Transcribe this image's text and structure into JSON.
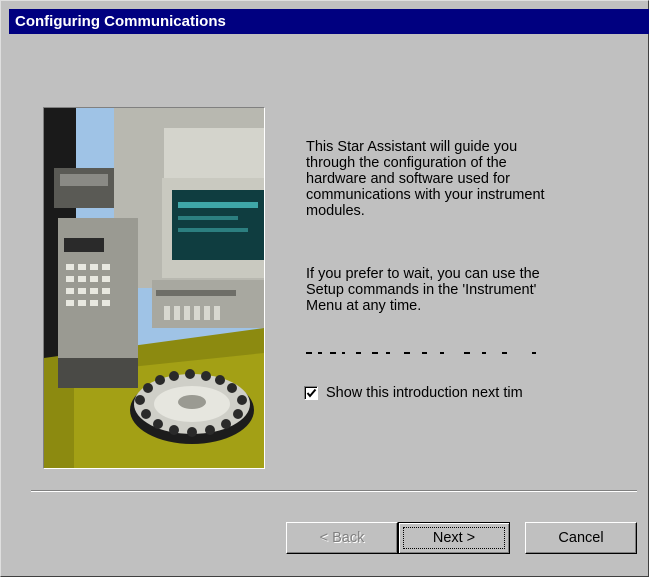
{
  "window": {
    "title": "Configuring Communications"
  },
  "intro": {
    "paragraph1": "This Star Assistant will guide you\nthrough the configuration of the\nhardware and software used for\ncommunications with your instrument\nmodules.",
    "paragraph2": "If you prefer to wait, you can use the\nSetup commands in the 'Instrument'\nMenu at any time."
  },
  "checkbox": {
    "label": "Show this introduction next tim",
    "checked": true
  },
  "buttons": {
    "back_label": "< Back",
    "next_label": "Next >",
    "cancel_label": "Cancel",
    "back_enabled": false
  },
  "colors": {
    "titlebar": "#000080",
    "dialog_bg": "#c0c0c0"
  }
}
